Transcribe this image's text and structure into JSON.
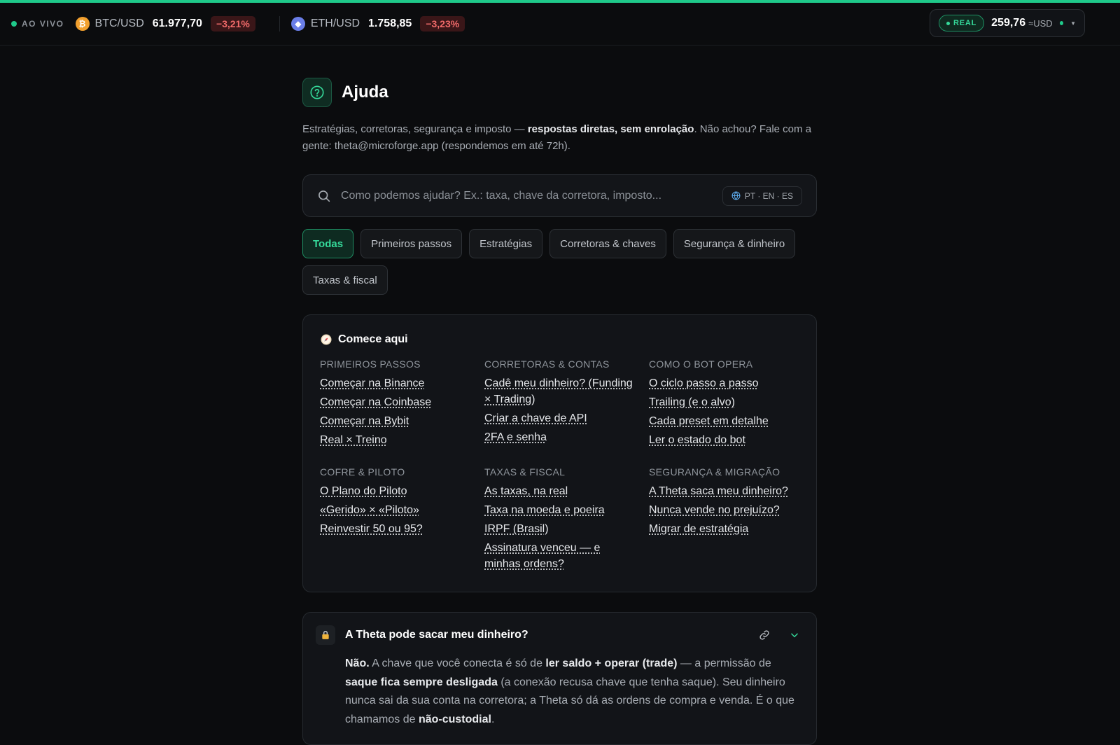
{
  "ticker": {
    "live_label": "AO VIVO",
    "pairs": [
      {
        "icon": "bitcoin-icon",
        "symbol": "₿",
        "name": "BTC/USD",
        "price": "61.977,70",
        "change": "−3,21%"
      },
      {
        "icon": "ethereum-icon",
        "symbol": "◆",
        "name": "ETH/USD",
        "price": "1.758,85",
        "change": "−3,23%"
      }
    ]
  },
  "account": {
    "mode": "REAL",
    "balance": "259,76",
    "unit": "≈USD"
  },
  "page": {
    "title": "Ajuda",
    "intro_pre": "Estratégias, corretoras, segurança e imposto — ",
    "intro_bold": "respostas diretas, sem enrolação",
    "intro_post": ". Não achou? Fale com a gente: theta@microforge.app (respondemos em até 72h)."
  },
  "search": {
    "placeholder": "Como podemos ajudar? Ex.: taxa, chave da corretora, imposto...",
    "languages": "PT · EN · ES"
  },
  "filters": [
    "Todas",
    "Primeiros passos",
    "Estratégias",
    "Corretoras & chaves",
    "Segurança & dinheiro",
    "Taxas & fiscal"
  ],
  "start_here": {
    "title": "Comece aqui",
    "groups": [
      {
        "heading": "PRIMEIROS PASSOS",
        "links": [
          "Começar na Binance",
          "Começar na Coinbase",
          "Começar na Bybit",
          "Real × Treino"
        ]
      },
      {
        "heading": "CORRETORAS & CONTAS",
        "links": [
          "Cadê meu dinheiro? (Funding × Trading)",
          "Criar a chave de API",
          "2FA e senha"
        ]
      },
      {
        "heading": "COMO O BOT OPERA",
        "links": [
          "O ciclo passo a passo",
          "Trailing (e o alvo)",
          "Cada preset em detalhe",
          "Ler o estado do bot"
        ]
      },
      {
        "heading": "COFRE & PILOTO",
        "links": [
          "O Plano do Piloto",
          "«Gerido» × «Piloto»",
          "Reinvestir 50 ou 95?"
        ]
      },
      {
        "heading": "TAXAS & FISCAL",
        "links": [
          "As taxas, na real",
          "Taxa na moeda e poeira",
          "IRPF (Brasil)",
          "Assinatura venceu — e minhas ordens?"
        ]
      },
      {
        "heading": "SEGURANÇA & MIGRAÇÃO",
        "links": [
          "A Theta saca meu dinheiro?",
          "Nunca vende no prejuízo?",
          "Migrar de estratégia"
        ]
      }
    ]
  },
  "faq": {
    "question": "A Theta pode sacar meu dinheiro?",
    "a1_bold": "Não.",
    "a2": " A chave que você conecta é só de ",
    "a3_bold": "ler saldo + operar (trade)",
    "a4": " — a permissão de ",
    "a5_bold": "saque fica sempre desligada",
    "a6": " (a conexão recusa chave que tenha saque). Seu dinheiro nunca sai da sua conta na corretora; a Theta só dá as ordens de compra e venda. É o que chamamos de ",
    "a7_bold": "não-custodial",
    "a8": "."
  },
  "colors": {
    "accent": "#1fc98a",
    "negative": "#f06a6a",
    "background": "#0b0c0e"
  }
}
